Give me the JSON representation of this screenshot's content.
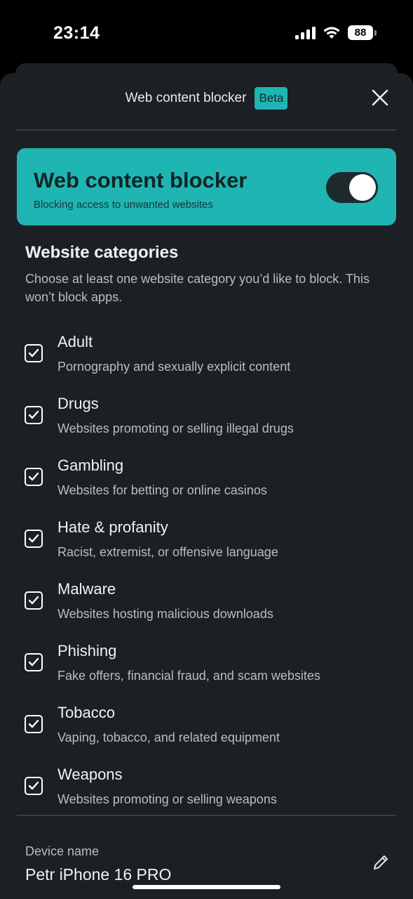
{
  "status_bar": {
    "time": "23:14",
    "battery": "88",
    "icons": [
      "signal-icon",
      "wifi-icon",
      "battery-icon"
    ]
  },
  "header": {
    "title": "Web content blocker",
    "badge": "Beta",
    "close_icon": "close-icon"
  },
  "hero": {
    "title": "Web content blocker",
    "subtitle": "Blocking access to unwanted websites",
    "toggle_on": true,
    "color": "#1fb5b2"
  },
  "categories_section": {
    "title": "Website categories",
    "description": "Choose at least one website category you’d like to block. This won’t block apps.",
    "items": [
      {
        "title": "Adult",
        "description": "Pornography and sexually explicit content",
        "checked": true
      },
      {
        "title": "Drugs",
        "description": "Websites promoting or selling illegal drugs",
        "checked": true
      },
      {
        "title": "Gambling",
        "description": "Websites for betting or online casinos",
        "checked": true
      },
      {
        "title": "Hate & profanity",
        "description": "Racist, extremist, or offensive language",
        "checked": true
      },
      {
        "title": "Malware",
        "description": "Websites hosting malicious downloads",
        "checked": true
      },
      {
        "title": "Phishing",
        "description": "Fake offers, financial fraud, and scam websites",
        "checked": true
      },
      {
        "title": "Tobacco",
        "description": "Vaping, tobacco, and related equipment",
        "checked": true
      },
      {
        "title": "Weapons",
        "description": "Websites promoting or selling weapons",
        "checked": true
      }
    ]
  },
  "device": {
    "label": "Device name",
    "value": "Petr iPhone 16 PRO",
    "edit_icon": "pencil-icon"
  }
}
